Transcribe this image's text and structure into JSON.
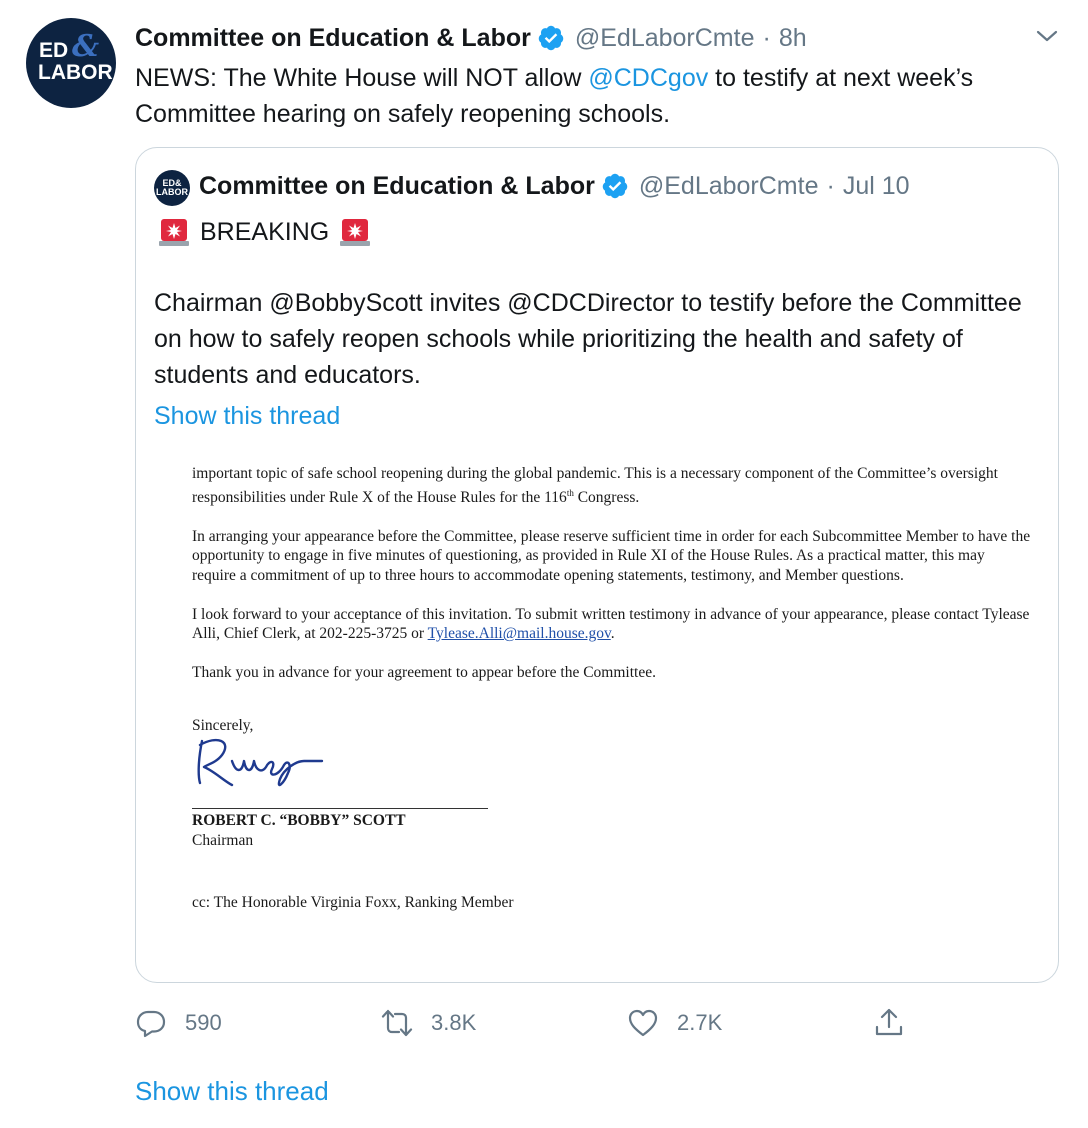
{
  "tweet": {
    "avatar": {
      "line1": "ED",
      "amp": "&",
      "line2": "LABOR"
    },
    "author_name": "Committee on Education & Labor",
    "handle": "@EdLaborCmte",
    "separator": "·",
    "time": "8h",
    "text_before": "NEWS: The White House will NOT allow ",
    "mention": "@CDCgov",
    "text_after": " to testify at next week’s Committee hearing on safely reopening schools."
  },
  "quote": {
    "avatar_text": "ED&\nLABOR",
    "author_name": "Committee on Education & Labor",
    "handle": "@EdLaborCmte",
    "separator": "·",
    "time": "Jul 10",
    "breaking": "BREAKING",
    "body": "Chairman @BobbyScott invites @CDCDirector to testify before the Committee on how to safely reopen schools while prioritizing the health and safety of students and educators.",
    "show_thread": "Show this thread"
  },
  "letter": {
    "p1_a": "important topic of safe school reopening during the global pandemic. This is a necessary component of the Committee’s oversight responsibilities under Rule X of the House Rules for the 116",
    "p1_sup": "th",
    "p1_b": " Congress.",
    "p2": "In arranging your appearance before the Committee, please reserve sufficient time in order for each Subcommittee Member to have the opportunity to engage in five minutes of questioning, as provided in Rule XI of the House Rules. As a practical matter, this may require a commitment of up to three hours to accommodate opening statements, testimony, and Member questions.",
    "p3_a": "I look forward to your acceptance of this invitation. To submit written testimony in advance of your appearance, please contact Tylease Alli, Chief Clerk, at 202-225-3725 or ",
    "p3_email": "Tylease.Alli@mail.house.gov",
    "p3_b": ".",
    "p4": "Thank you in advance for your agreement to appear before the Committee.",
    "closing": "Sincerely,",
    "signer": "ROBERT C. “BOBBY” SCOTT",
    "signer_title": "Chairman",
    "cc": "cc: The Honorable Virginia Foxx, Ranking Member"
  },
  "actions": {
    "reply_count": "590",
    "retweet_count": "3.8K",
    "like_count": "2.7K",
    "reply_icon": "reply-icon",
    "retweet_icon": "retweet-icon",
    "like_icon": "heart-icon",
    "share_icon": "share-icon"
  },
  "show_thread": "Show this thread",
  "colors": {
    "link": "#1b95e0",
    "muted": "#657786",
    "text": "#14171a",
    "verified": "#1da1f2",
    "avatar_bg": "#0d2341",
    "border": "#ccd6dd"
  }
}
